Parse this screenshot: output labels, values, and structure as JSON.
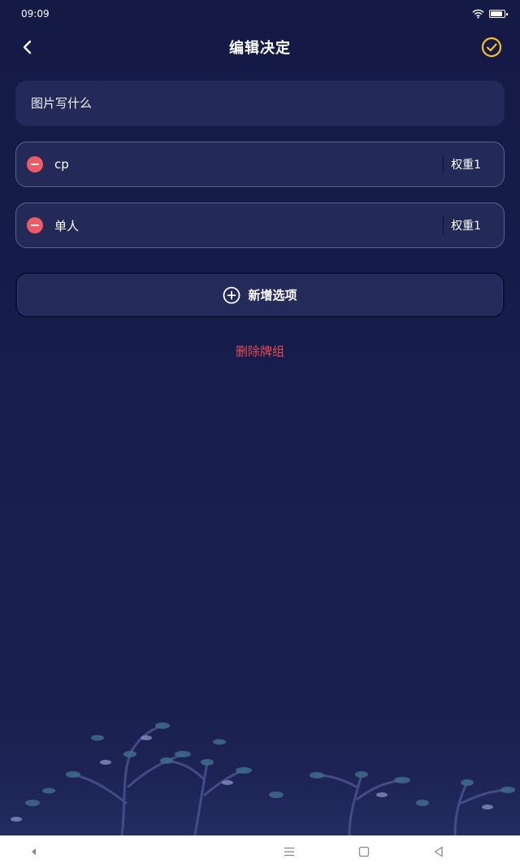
{
  "status_bar": {
    "time": "09:09"
  },
  "header": {
    "title": "编辑决定"
  },
  "deck": {
    "title_placeholder": "图片写什么"
  },
  "options": [
    {
      "value": "cp",
      "weight_label": "权重1"
    },
    {
      "value": "单人",
      "weight_label": "权重1"
    }
  ],
  "actions": {
    "add_option_label": "新增选项",
    "delete_deck_label": "删除牌组"
  },
  "colors": {
    "background": "#181d47",
    "field": "#232a5a",
    "accent_confirm": "#f5c02e",
    "remove": "#ee5b66",
    "danger_text": "#e6494f"
  },
  "icons": [
    "wifi-icon",
    "battery-icon",
    "back-icon",
    "check-circle-icon",
    "minus-circle-icon",
    "plus-circle-icon",
    "menu-icon",
    "home-icon",
    "back-triangle-icon"
  ]
}
